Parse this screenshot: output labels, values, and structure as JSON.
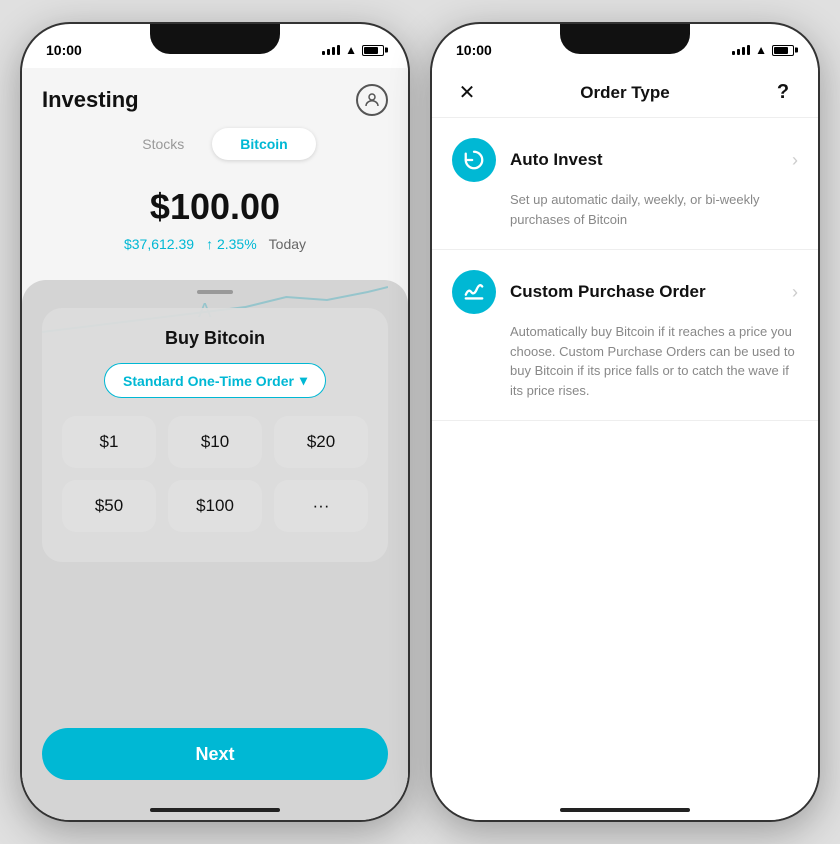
{
  "left_phone": {
    "status": {
      "time": "10:00"
    },
    "header": {
      "title": "Investing",
      "profile_label": "profile"
    },
    "tabs": [
      {
        "label": "Stocks",
        "active": false
      },
      {
        "label": "Bitcoin",
        "active": true
      }
    ],
    "price": {
      "main": "$100.00",
      "btc_price": "$37,612.39",
      "change": "↑ 2.35%",
      "period": "Today"
    },
    "sheet": {
      "title": "Buy Bitcoin",
      "order_type": "Standard One-Time Order ✓",
      "order_type_label": "Standard One-Time Order",
      "amounts": [
        "$1",
        "$10",
        "$20",
        "$50",
        "$100",
        "···"
      ],
      "next_button": "Next"
    }
  },
  "right_phone": {
    "status": {
      "time": "10:00"
    },
    "header": {
      "close": "✕",
      "title": "Order Type",
      "help": "?"
    },
    "options": [
      {
        "icon": "↻",
        "name": "Auto Invest",
        "description": "Set up automatic daily, weekly, or bi-weekly purchases of Bitcoin"
      },
      {
        "icon": "~",
        "name": "Custom Purchase Order",
        "description": "Automatically buy Bitcoin if it reaches a price you choose. Custom Purchase Orders can be used to buy Bitcoin if its price falls or to catch the wave if its price rises."
      }
    ]
  }
}
